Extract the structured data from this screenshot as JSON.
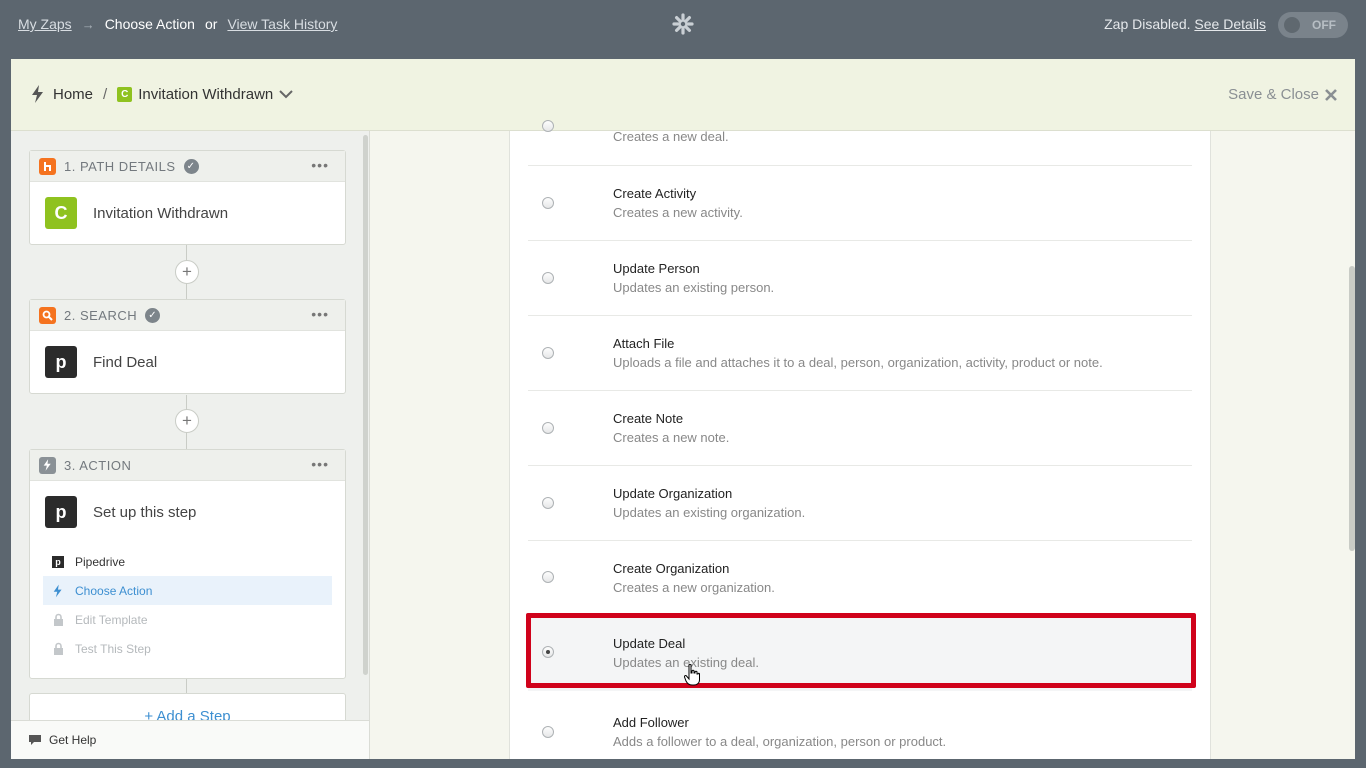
{
  "topbar": {
    "my_zaps": "My Zaps",
    "arrow": "→",
    "current": "Choose Action",
    "or": "or",
    "view_history": "View Task History",
    "status_text": "Zap Disabled.",
    "see_details": "See Details",
    "toggle_label": "OFF"
  },
  "header": {
    "home": "Home",
    "separator": "/",
    "app_badge": "C",
    "zap_name": "Invitation Withdrawn",
    "save_close": "Save & Close"
  },
  "sidebar": {
    "steps": [
      {
        "label": "1. PATH DETAILS",
        "badge": "C",
        "name": "Invitation Withdrawn",
        "dots": "•••"
      },
      {
        "label": "2. SEARCH",
        "badge": "p",
        "name": "Find Deal",
        "dots": "•••"
      },
      {
        "label": "3. ACTION",
        "badge": "p",
        "name": "Set up this step",
        "dots": "•••"
      }
    ],
    "substeps": [
      {
        "label": "Pipedrive",
        "icon": "pipedrive-icon"
      },
      {
        "label": "Choose Action",
        "icon": "bolt-icon"
      },
      {
        "label": "Edit Template",
        "icon": "lock-icon"
      },
      {
        "label": "Test This Step",
        "icon": "lock-icon"
      }
    ],
    "add_step": "+ Add a Step",
    "help": "Get Help"
  },
  "actions": [
    {
      "title": "",
      "desc": "Creates a new deal."
    },
    {
      "title": "Create Activity",
      "desc": "Creates a new activity."
    },
    {
      "title": "Update Person",
      "desc": "Updates an existing person."
    },
    {
      "title": "Attach File",
      "desc": "Uploads a file and attaches it to a deal, person, organization, activity, product or note."
    },
    {
      "title": "Create Note",
      "desc": "Creates a new note."
    },
    {
      "title": "Update Organization",
      "desc": "Updates an existing organization."
    },
    {
      "title": "Create Organization",
      "desc": "Creates a new organization."
    },
    {
      "title": "Update Deal",
      "desc": "Updates an existing deal.",
      "selected": true
    },
    {
      "title": "Add Follower",
      "desc": "Adds a follower to a deal, organization, person or product."
    }
  ],
  "colors": {
    "topbar": "#5c666f",
    "accent_blue": "#3d8fd1",
    "highlight_red": "#d0021b",
    "c_green": "#8fc21f",
    "path_orange": "#f5731f"
  }
}
